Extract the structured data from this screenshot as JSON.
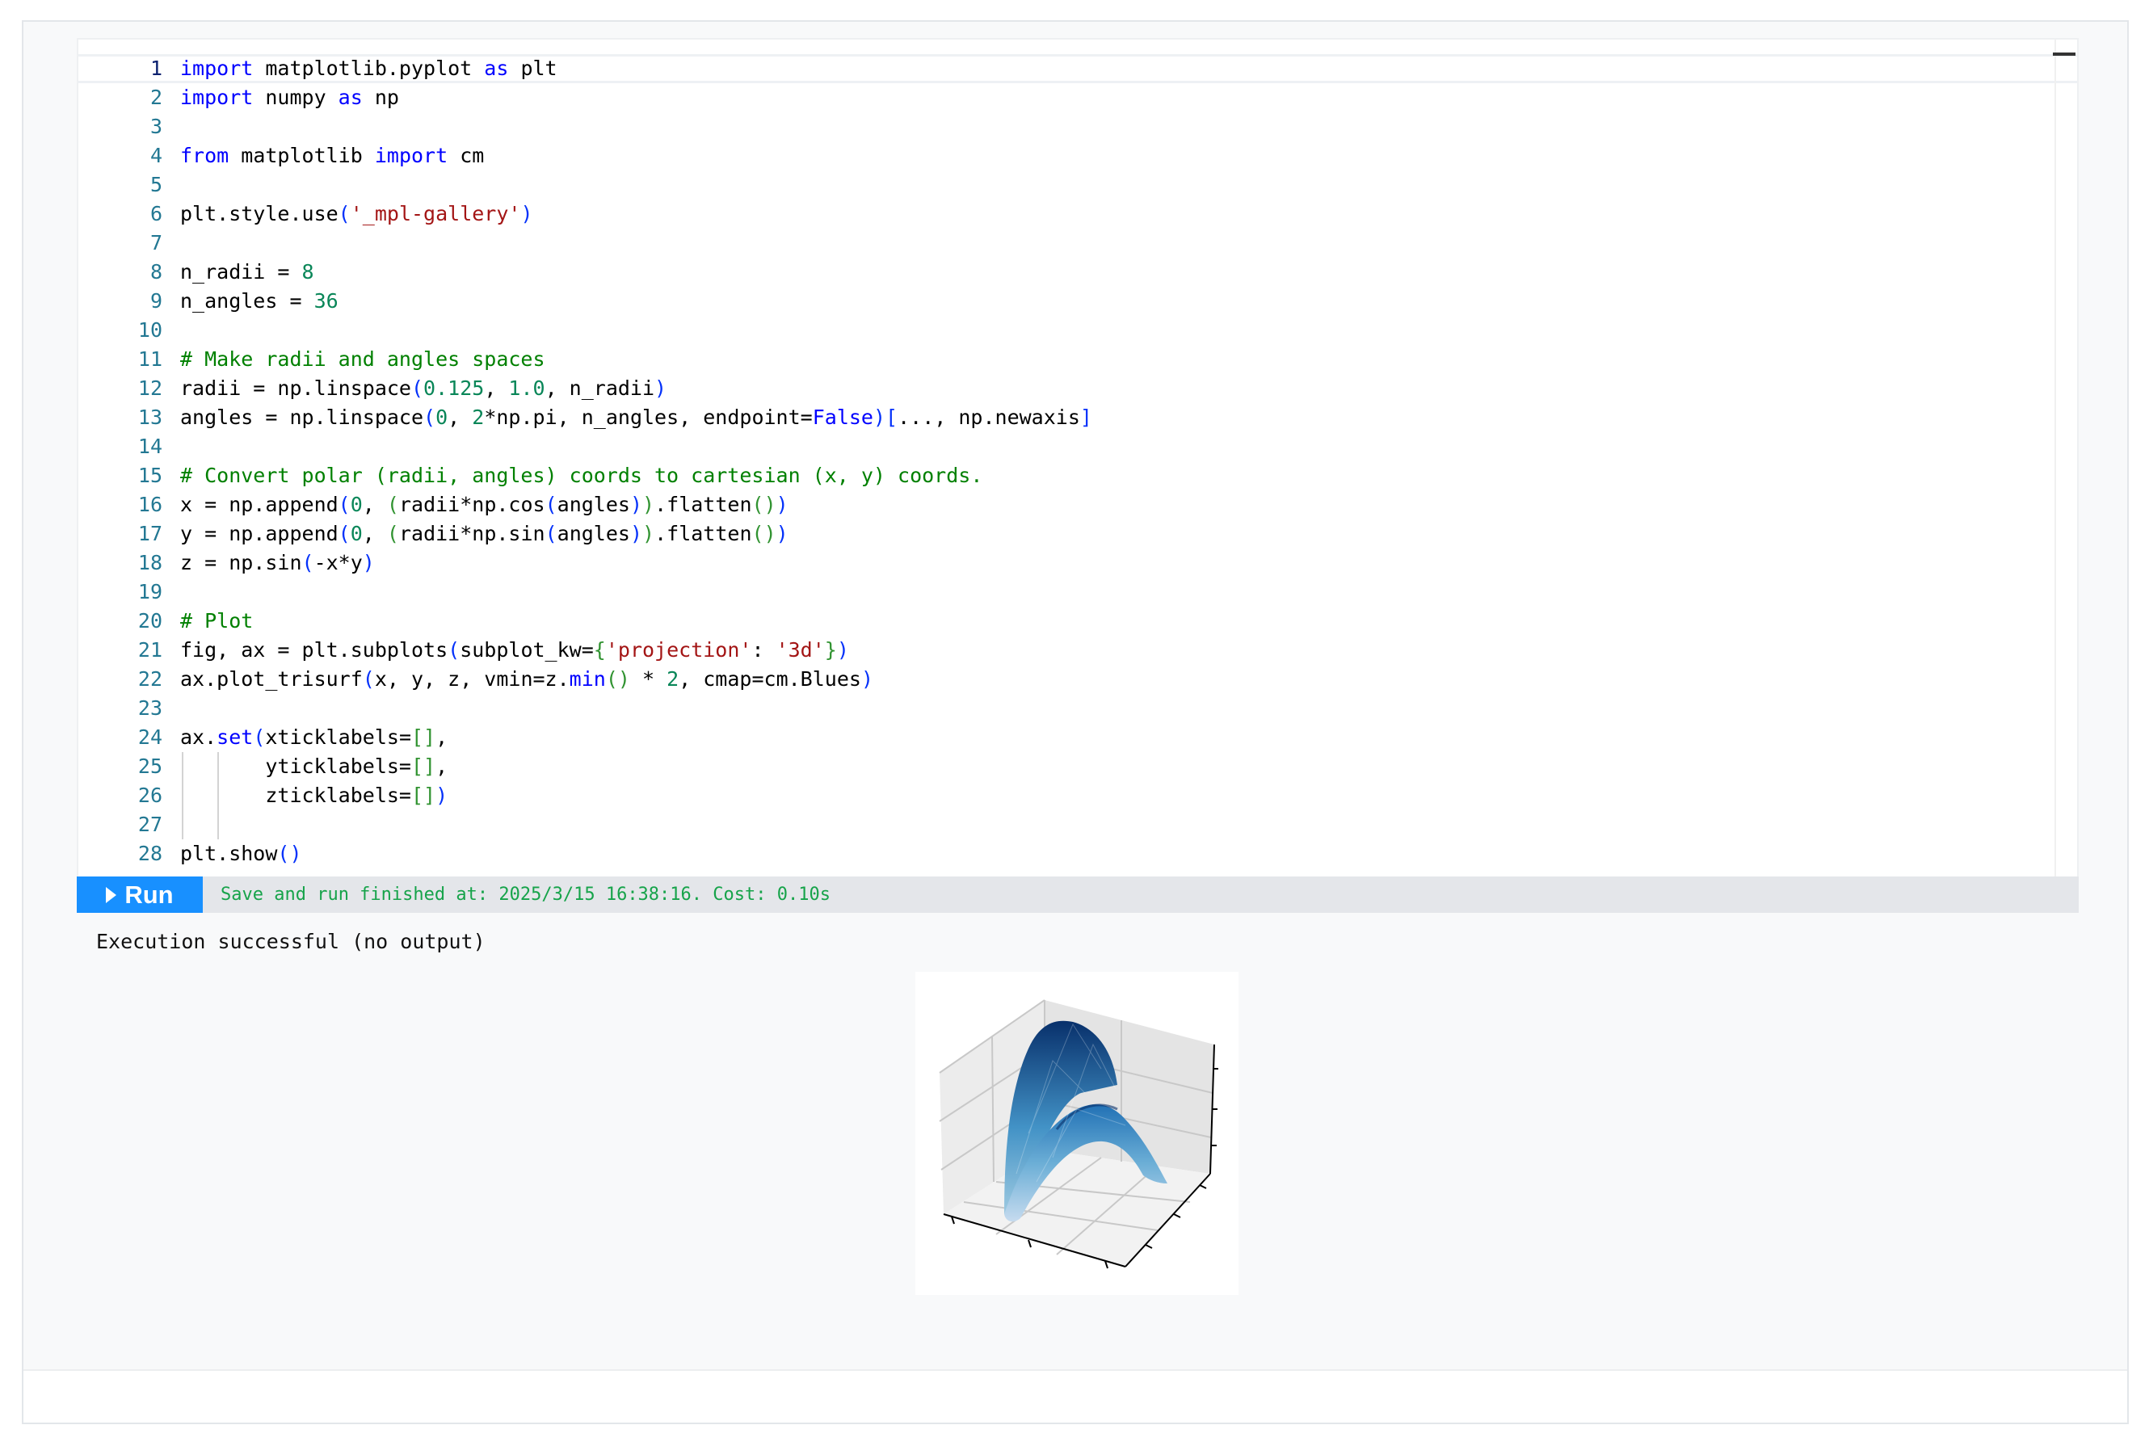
{
  "code_lines": [
    {
      "n": "1",
      "parts": [
        [
          "kw",
          "import"
        ],
        [
          "t",
          " matplotlib.pyplot "
        ],
        [
          "kw",
          "as"
        ],
        [
          "t",
          " plt"
        ]
      ]
    },
    {
      "n": "2",
      "parts": [
        [
          "kw",
          "import"
        ],
        [
          "t",
          " numpy "
        ],
        [
          "kw",
          "as"
        ],
        [
          "t",
          " np"
        ]
      ]
    },
    {
      "n": "3",
      "parts": []
    },
    {
      "n": "4",
      "parts": [
        [
          "kw",
          "from"
        ],
        [
          "t",
          " matplotlib "
        ],
        [
          "kw",
          "import"
        ],
        [
          "t",
          " cm"
        ]
      ]
    },
    {
      "n": "5",
      "parts": []
    },
    {
      "n": "6",
      "parts": [
        [
          "t",
          "plt.style.use"
        ],
        [
          "br2",
          "("
        ],
        [
          "str",
          "'_mpl-gallery'"
        ],
        [
          "br2",
          ")"
        ]
      ]
    },
    {
      "n": "7",
      "parts": []
    },
    {
      "n": "8",
      "parts": [
        [
          "t",
          "n_radii = "
        ],
        [
          "num",
          "8"
        ]
      ]
    },
    {
      "n": "9",
      "parts": [
        [
          "t",
          "n_angles = "
        ],
        [
          "num",
          "36"
        ]
      ]
    },
    {
      "n": "10",
      "parts": []
    },
    {
      "n": "11",
      "parts": [
        [
          "cmt",
          "# Make radii and angles spaces"
        ]
      ]
    },
    {
      "n": "12",
      "parts": [
        [
          "t",
          "radii = np.linspace"
        ],
        [
          "br2",
          "("
        ],
        [
          "num",
          "0.125"
        ],
        [
          "t",
          ", "
        ],
        [
          "num",
          "1.0"
        ],
        [
          "t",
          ", n_radii"
        ],
        [
          "br2",
          ")"
        ]
      ]
    },
    {
      "n": "13",
      "parts": [
        [
          "t",
          "angles = np.linspace"
        ],
        [
          "br2",
          "("
        ],
        [
          "num",
          "0"
        ],
        [
          "t",
          ", "
        ],
        [
          "num",
          "2"
        ],
        [
          "t",
          "*np.pi, n_angles, endpoint="
        ],
        [
          "kw",
          "False"
        ],
        [
          "br2",
          ")"
        ],
        [
          "br2",
          "["
        ],
        [
          "t",
          "..., np.newaxis"
        ],
        [
          "br2",
          "]"
        ]
      ]
    },
    {
      "n": "14",
      "parts": []
    },
    {
      "n": "15",
      "parts": [
        [
          "cmt",
          "# Convert polar (radii, angles) coords to cartesian (x, y) coords."
        ]
      ]
    },
    {
      "n": "16",
      "parts": [
        [
          "t",
          "x = np.append"
        ],
        [
          "br2",
          "("
        ],
        [
          "num",
          "0"
        ],
        [
          "t",
          ", "
        ],
        [
          "br1",
          "("
        ],
        [
          "t",
          "radii*np.cos"
        ],
        [
          "br2",
          "("
        ],
        [
          "t",
          "angles"
        ],
        [
          "br2",
          ")"
        ],
        [
          "br1",
          ")"
        ],
        [
          "t",
          ".flatten"
        ],
        [
          "br1",
          "()"
        ],
        [
          "br2",
          ")"
        ]
      ]
    },
    {
      "n": "17",
      "parts": [
        [
          "t",
          "y = np.append"
        ],
        [
          "br2",
          "("
        ],
        [
          "num",
          "0"
        ],
        [
          "t",
          ", "
        ],
        [
          "br1",
          "("
        ],
        [
          "t",
          "radii*np.sin"
        ],
        [
          "br2",
          "("
        ],
        [
          "t",
          "angles"
        ],
        [
          "br2",
          ")"
        ],
        [
          "br1",
          ")"
        ],
        [
          "t",
          ".flatten"
        ],
        [
          "br1",
          "()"
        ],
        [
          "br2",
          ")"
        ]
      ]
    },
    {
      "n": "18",
      "parts": [
        [
          "t",
          "z = np.sin"
        ],
        [
          "br2",
          "("
        ],
        [
          "t",
          "-x*y"
        ],
        [
          "br2",
          ")"
        ]
      ]
    },
    {
      "n": "19",
      "parts": []
    },
    {
      "n": "20",
      "parts": [
        [
          "cmt",
          "# Plot"
        ]
      ]
    },
    {
      "n": "21",
      "parts": [
        [
          "t",
          "fig, ax = plt.subplots"
        ],
        [
          "br2",
          "("
        ],
        [
          "t",
          "subplot_kw="
        ],
        [
          "br1",
          "{"
        ],
        [
          "str",
          "'projection'"
        ],
        [
          "t",
          ": "
        ],
        [
          "str",
          "'3d'"
        ],
        [
          "br1",
          "}"
        ],
        [
          "br2",
          ")"
        ]
      ]
    },
    {
      "n": "22",
      "parts": [
        [
          "t",
          "ax.plot_trisurf"
        ],
        [
          "br2",
          "("
        ],
        [
          "t",
          "x, y, z, vmin=z."
        ],
        [
          "kw",
          "min"
        ],
        [
          "br1",
          "()"
        ],
        [
          "t",
          " * "
        ],
        [
          "num",
          "2"
        ],
        [
          "t",
          ", cmap=cm.Blues"
        ],
        [
          "br2",
          ")"
        ]
      ]
    },
    {
      "n": "23",
      "parts": []
    },
    {
      "n": "24",
      "parts": [
        [
          "t",
          "ax."
        ],
        [
          "kw",
          "set"
        ],
        [
          "br2",
          "("
        ],
        [
          "t",
          "xticklabels="
        ],
        [
          "br1",
          "[]"
        ],
        [
          "t",
          ","
        ]
      ]
    },
    {
      "n": "25",
      "parts": [
        [
          "t",
          "       yticklabels="
        ],
        [
          "br1",
          "[]"
        ],
        [
          "t",
          ","
        ]
      ],
      "guides": true
    },
    {
      "n": "26",
      "parts": [
        [
          "t",
          "       zticklabels="
        ],
        [
          "br1",
          "[]"
        ],
        [
          "br2",
          ")"
        ]
      ],
      "guides": true
    },
    {
      "n": "27",
      "parts": [],
      "guides": true
    },
    {
      "n": "28",
      "parts": [
        [
          "t",
          "plt.show"
        ],
        [
          "br2",
          "()"
        ]
      ]
    }
  ],
  "run_bar": {
    "run_label": "Run",
    "status": "Save and run finished at: 2025/3/15 16:38:16. Cost: 0.10s"
  },
  "output": {
    "message": "Execution successful (no output)"
  },
  "colors": {
    "run_button": "#1890ff",
    "status_text": "#16a34a",
    "keyword": "#0000ff",
    "string": "#a31515",
    "number": "#098658",
    "comment": "#008000"
  },
  "icons": [
    "play-icon"
  ]
}
